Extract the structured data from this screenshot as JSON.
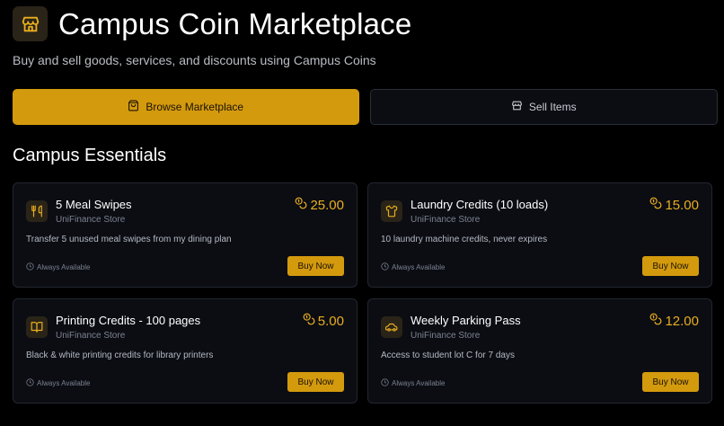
{
  "header": {
    "title": "Campus Coin Marketplace",
    "subtitle": "Buy and sell goods, services, and discounts using Campus Coins",
    "icon": "store-icon"
  },
  "tabs": [
    {
      "label": "Browse Marketplace",
      "icon": "bag-icon",
      "active": true
    },
    {
      "label": "Sell Items",
      "icon": "store-icon",
      "active": false
    }
  ],
  "section": {
    "title": "Campus Essentials"
  },
  "items": [
    {
      "name": "5 Meal Swipes",
      "store": "UniFinance Store",
      "price": "25.00",
      "description": "Transfer 5 unused meal swipes from my dining plan",
      "availability": "Always Available",
      "button": "Buy Now",
      "icon": "utensils-icon"
    },
    {
      "name": "Laundry Credits (10 loads)",
      "store": "UniFinance Store",
      "price": "15.00",
      "description": "10 laundry machine credits, never expires",
      "availability": "Always Available",
      "button": "Buy Now",
      "icon": "shirt-icon"
    },
    {
      "name": "Printing Credits - 100 pages",
      "store": "UniFinance Store",
      "price": "5.00",
      "description": "Black & white printing credits for library printers",
      "availability": "Always Available",
      "button": "Buy Now",
      "icon": "book-icon"
    },
    {
      "name": "Weekly Parking Pass",
      "store": "UniFinance Store",
      "price": "12.00",
      "description": "Access to student lot C for 7 days",
      "availability": "Always Available",
      "button": "Buy Now",
      "icon": "car-icon"
    }
  ],
  "colors": {
    "accent": "#d49a0d",
    "price": "#e9ae1f",
    "background": "#000000",
    "card": "#0b0d13"
  }
}
